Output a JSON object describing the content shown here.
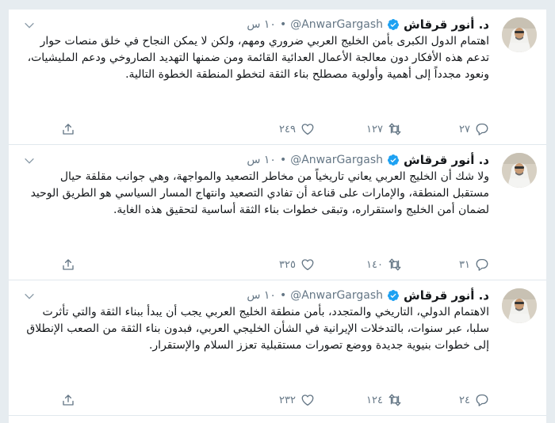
{
  "tweets": [
    {
      "name": "د. أنور قرقاش",
      "handle": "@AnwarGargash",
      "dot": "•",
      "time": "١٠ س",
      "text": "اهتمام الدول الكبرى بأمن الخليج العربي ضروري ومهم، ولكن لا يمكن النجاح في خلق منصات حوار تدعم هذه الأفكار دون معالجة الأعمال العدائية القائمة ومن ضمنها التهديد الصاروخي ودعم المليشيات، ونعود مجدداً إلى أهمية وأولوية مصطلح بناء الثقة لتخطو المنطقة الخطوة التالية.",
      "replies": "٢٧",
      "retweets": "١٢٧",
      "likes": "٢٤٩"
    },
    {
      "name": "د. أنور قرقاش",
      "handle": "@AnwarGargash",
      "dot": "•",
      "time": "١٠ س",
      "text": "ولا شك أن الخليج العربي يعاني تاريخياً من مخاطر التصعيد والمواجهة، وهي جوانب مقلقة حيال مستقبل المنطقة، والإمارات على قناعة أن تفادي التصعيد وانتهاج المسار السياسي هو الطريق الوحيد لضمان أمن الخليج واستقراره، وتبقى خطوات بناء الثقة أساسية لتحقيق هذه الغاية.",
      "replies": "٣١",
      "retweets": "١٤٠",
      "likes": "٣٢٥"
    },
    {
      "name": "د. أنور قرقاش",
      "handle": "@AnwarGargash",
      "dot": "•",
      "time": "١٠ س",
      "text": "الاهتمام الدولي، التاريخي والمتجدد، بأمن منطقة الخليج العربي يجب أن يبدأ ببناء الثقة والتي تأثرت سلبا، عبر سنوات، بالتدخلات الإيرانية في الشأن الخليجي العربي، فبدون بناء الثقة من الصعب الإنطلاق إلى خطوات بنيوية جديدة ووضع تصورات مستقبلية تعزز السلام والإستقرار.",
      "replies": "٢٤",
      "retweets": "١٢٤",
      "likes": "٢٣٢"
    }
  ],
  "colors": {
    "verified": "#1da1f2",
    "text": "#14171a",
    "muted": "#657786",
    "background": "#e6ecf0"
  },
  "icons": [
    "verified-badge-icon",
    "chevron-down-icon",
    "reply-icon",
    "retweet-icon",
    "like-icon",
    "share-icon"
  ]
}
